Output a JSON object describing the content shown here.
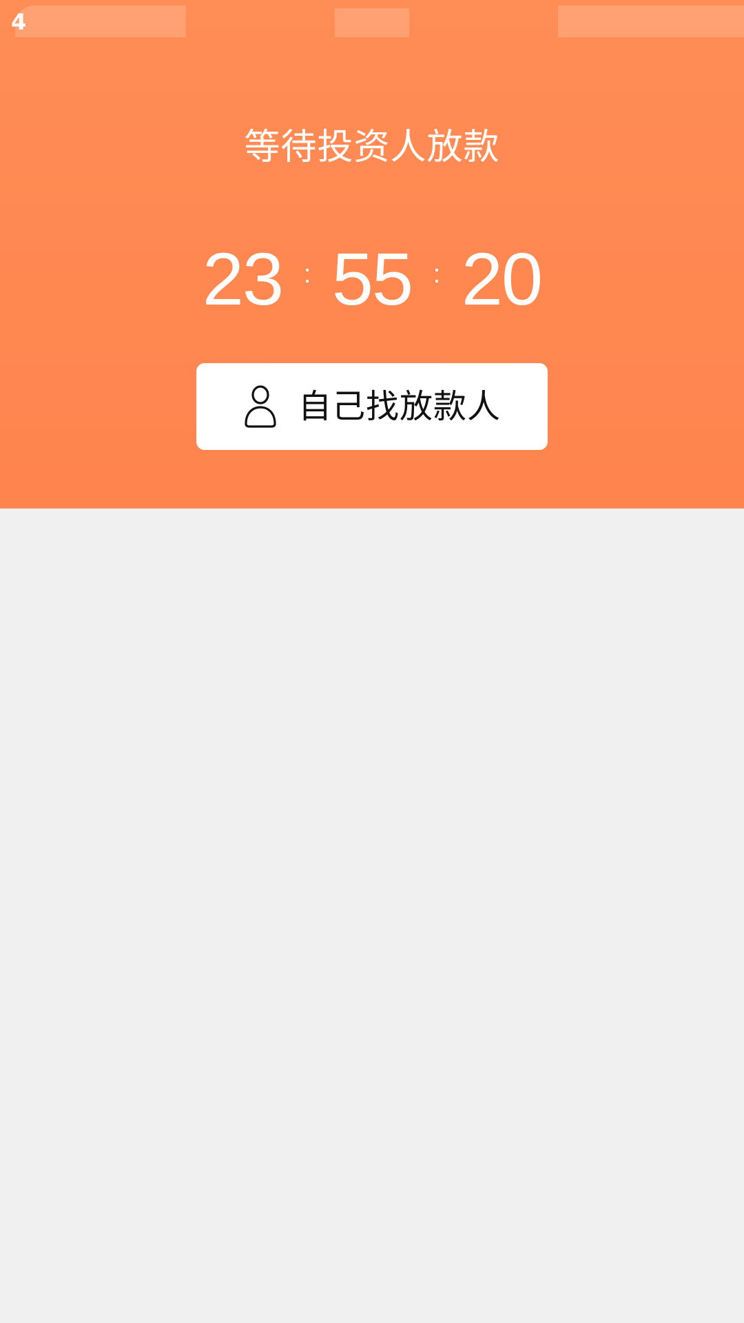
{
  "status_bar": {
    "partial_text": "4"
  },
  "header": {
    "title": "等待投资人放款",
    "countdown": {
      "hours": "23",
      "minutes": "55",
      "seconds": "20",
      "separator": ":"
    },
    "find_button": {
      "label": "自己找放款人",
      "icon": "person-icon"
    }
  },
  "colors": {
    "header_background": "#ff8a52",
    "page_background": "#f0f0f0",
    "button_background": "#ffffff",
    "button_text": "#111111",
    "header_text": "#ffffff"
  }
}
